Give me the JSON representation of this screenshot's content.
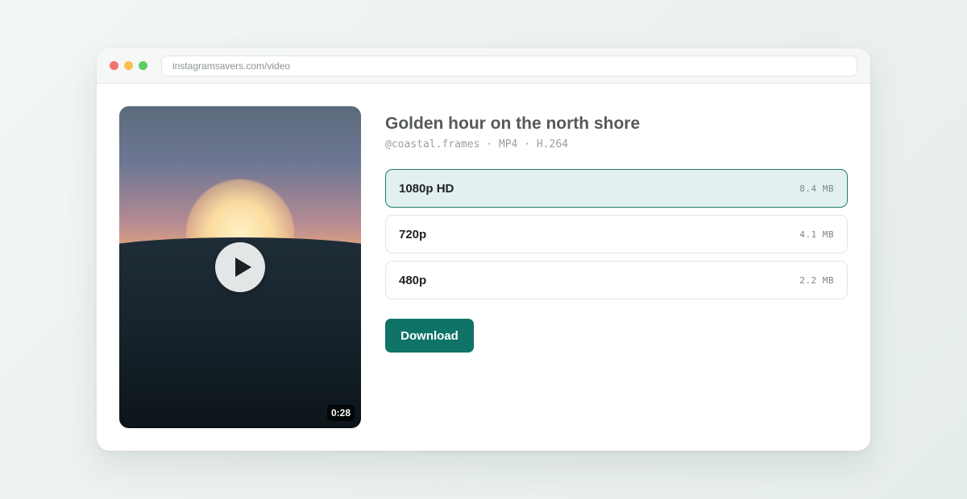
{
  "browser": {
    "url": "instagramsavers.com/video"
  },
  "video": {
    "duration": "0:28",
    "play_icon": "play-icon"
  },
  "post": {
    "title": "Golden hour on the north shore",
    "meta": "@coastal.frames · MP4 · H.264"
  },
  "quality_options": [
    {
      "label": "1080p HD",
      "size": "8.4 MB",
      "selected": true
    },
    {
      "label": "720p",
      "size": "4.1 MB",
      "selected": false
    },
    {
      "label": "480p",
      "size": "2.2 MB",
      "selected": false
    }
  ],
  "actions": {
    "download_label": "Download"
  },
  "colors": {
    "accent": "#0f7368",
    "selected_bg": "#e2f1ef",
    "window_dots": [
      "#f2726b",
      "#f5c04c",
      "#5ecb62"
    ]
  }
}
